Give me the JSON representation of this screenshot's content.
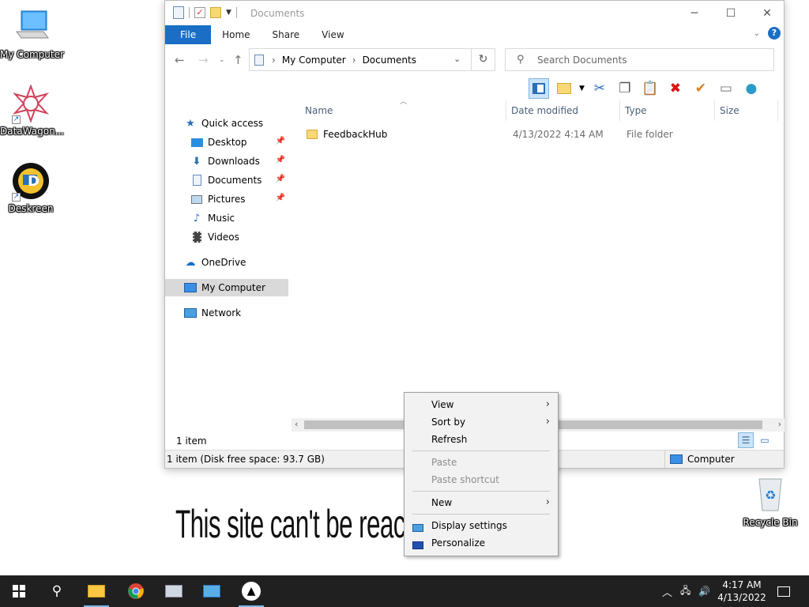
{
  "desktop": {
    "icons": [
      {
        "label": "My Computer"
      },
      {
        "label": "DataWagon..."
      },
      {
        "label": "Deskreen"
      },
      {
        "label": "Recycle Bin"
      }
    ]
  },
  "window": {
    "title": "Documents",
    "ribbon_tabs": [
      "File",
      "Home",
      "Share",
      "View"
    ],
    "address": {
      "crumbs": [
        "My Computer",
        "Documents"
      ]
    },
    "search": {
      "placeholder": "Search Documents"
    },
    "nav": {
      "quick_access": "Quick access",
      "items": [
        "Desktop",
        "Downloads",
        "Documents",
        "Pictures",
        "Music",
        "Videos"
      ],
      "onedrive": "OneDrive",
      "my_computer": "My Computer",
      "network": "Network"
    },
    "columns": {
      "name": "Name",
      "date": "Date modified",
      "type": "Type",
      "size": "Size"
    },
    "files": [
      {
        "name": "FeedbackHub",
        "date": "4/13/2022 4:14 AM",
        "type": "File folder",
        "size": ""
      }
    ],
    "item_count": "1 item",
    "status_left": "1 item (Disk free space: 93.7 GB)",
    "status_right": "Computer"
  },
  "context_menu": {
    "view": "View",
    "sort_by": "Sort by",
    "refresh": "Refresh",
    "paste": "Paste",
    "paste_shortcut": "Paste shortcut",
    "new": "New",
    "display_settings": "Display settings",
    "personalize": "Personalize"
  },
  "background_text": "This site can't be reached",
  "taskbar": {
    "time": "4:17 AM",
    "date": "4/13/2022"
  },
  "colors": {
    "accent": "#1a6fc4",
    "taskbar": "#202020",
    "selection": "#cce4f7"
  }
}
